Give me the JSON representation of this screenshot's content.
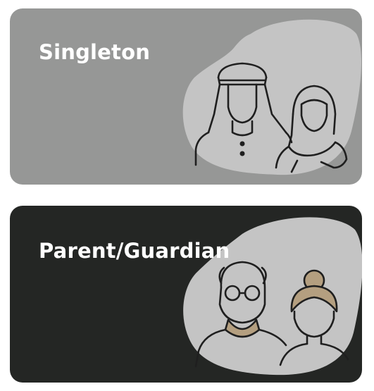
{
  "cards": [
    {
      "label": "Singleton",
      "background": "#969796",
      "blob_color": "#c4c4c4",
      "icon": "arab-couple-icon"
    },
    {
      "label": "Parent/Guardian",
      "background": "#242624",
      "blob_color": "#c4c4c4",
      "icon": "elderly-couple-icon",
      "accent": "#b49f80"
    }
  ],
  "colors": {
    "line": "#1f1f1f"
  }
}
